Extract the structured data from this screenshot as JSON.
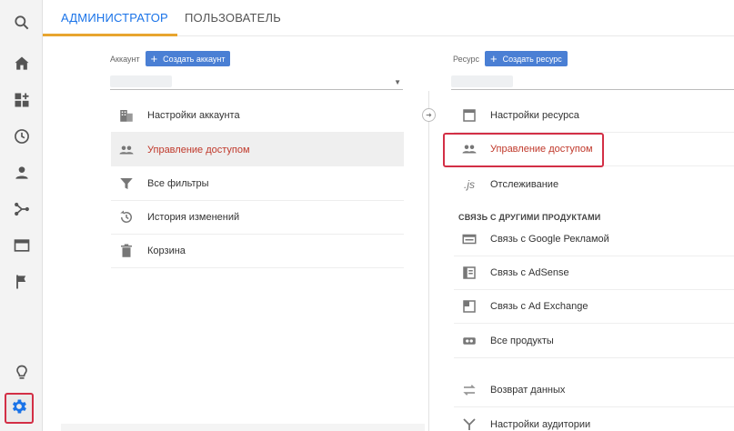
{
  "rail": {
    "items": [
      {
        "icon": "search-icon"
      },
      {
        "icon": "home-icon"
      },
      {
        "icon": "customization-icon"
      },
      {
        "icon": "clock-icon"
      },
      {
        "icon": "person-icon"
      },
      {
        "icon": "acquisition-icon"
      },
      {
        "icon": "behavior-icon"
      },
      {
        "icon": "flag-icon"
      },
      {
        "icon": "lightbulb-icon"
      },
      {
        "icon": "gear-icon"
      }
    ],
    "accent": "#1a73e8",
    "highlight_color": "#d32f46"
  },
  "tabs": {
    "admin": "АДМИНИСТРАТОР",
    "user": "ПОЛЬЗОВАТЕЛЬ"
  },
  "account": {
    "label": "Аккаунт",
    "create_button": "Создать аккаунт",
    "items": [
      {
        "label": "Настройки аккаунта",
        "icon": "building-icon"
      },
      {
        "label": "Управление доступом",
        "icon": "people-icon"
      },
      {
        "label": "Все фильтры",
        "icon": "filter-icon"
      },
      {
        "label": "История изменений",
        "icon": "history-icon"
      },
      {
        "label": "Корзина",
        "icon": "trash-icon"
      }
    ]
  },
  "property": {
    "label": "Ресурс",
    "create_button": "Создать ресурс",
    "items": [
      {
        "label": "Настройки ресурса",
        "icon": "square-icon"
      },
      {
        "label": "Управление доступом",
        "icon": "people-icon"
      },
      {
        "label": "Отслеживание",
        "icon": "js-icon"
      }
    ],
    "section_title": "СВЯЗЬ С ДРУГИМИ ПРОДУКТАМИ",
    "linked": [
      {
        "label": "Связь с Google Рекламой",
        "icon": "ads-icon"
      },
      {
        "label": "Связь с AdSense",
        "icon": "adsense-icon"
      },
      {
        "label": "Связь с Ad Exchange",
        "icon": "adexchange-icon"
      },
      {
        "label": "Все продукты",
        "icon": "link-icon"
      }
    ],
    "more": [
      {
        "label": "Возврат данных",
        "icon": "swap-icon"
      },
      {
        "label": "Настройки аудитории",
        "icon": "audience-icon"
      }
    ]
  }
}
